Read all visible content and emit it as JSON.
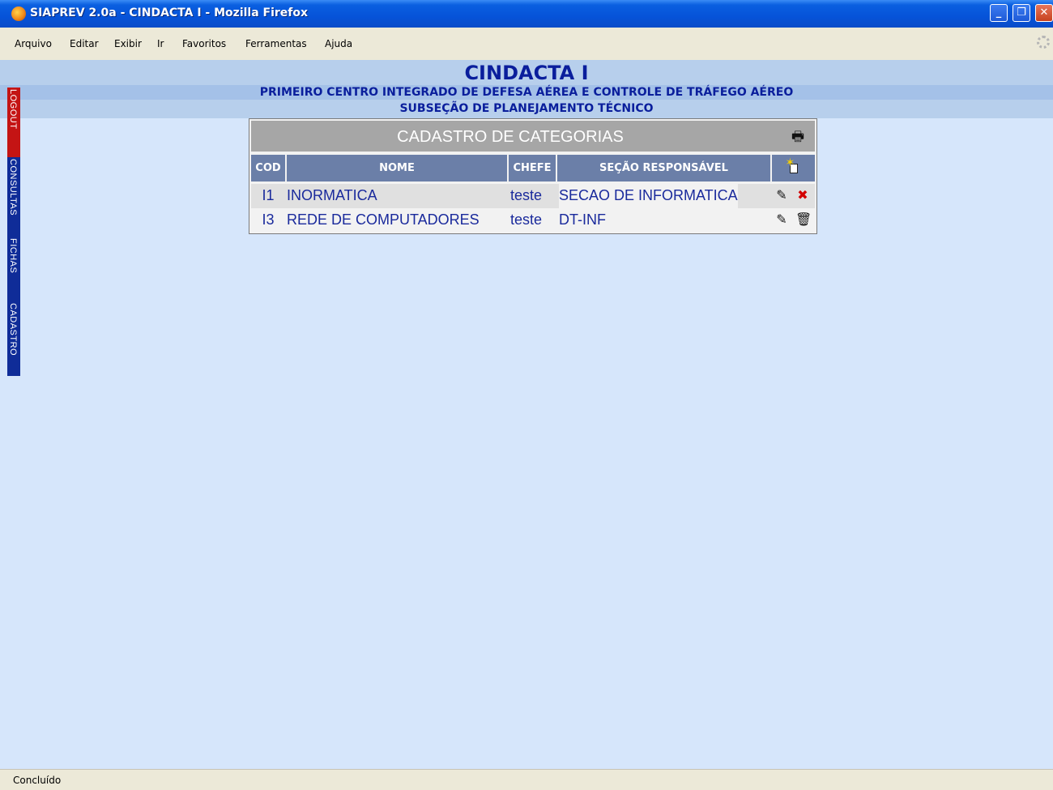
{
  "window": {
    "title": "SIAPREV 2.0a - CINDACTA I - Mozilla Firefox",
    "controls": {
      "minimize": "_",
      "maximize": "❐",
      "close": "✕"
    }
  },
  "menu": [
    "Arquivo",
    "Editar",
    "Exibir",
    "Ir",
    "Favoritos",
    "Ferramentas",
    "Ajuda"
  ],
  "header": {
    "title": "CINDACTA I",
    "subtitle1": "PRIMEIRO CENTRO INTEGRADO DE DEFESA AÉREA E CONTROLE DE TRÁFEGO AÉREO",
    "subtitle2": "SUBSEÇÃO DE PLANEJAMENTO TÉCNICO"
  },
  "sidebar_tabs": [
    "LOGOUT",
    "CONSULTAS",
    "FICHAS",
    "CADASTRO"
  ],
  "table": {
    "title": "CADASTRO DE CATEGORIAS",
    "columns": [
      "COD",
      "NOME",
      "CHEFE",
      "SEÇÃO RESPONSÁVEL"
    ],
    "rows": [
      {
        "cod": "I1",
        "nome": "INORMATICA",
        "chefe": "teste",
        "secao": "SECAO DE INFORMATICA",
        "delete_icon": "delete-disabled-icon"
      },
      {
        "cod": "I3",
        "nome": "REDE DE COMPUTADORES",
        "chefe": "teste",
        "secao": "DT-INF",
        "delete_icon": "trash-icon"
      }
    ],
    "icons": {
      "print": "print-icon",
      "new": "new-record-icon",
      "edit": "edit-icon"
    }
  },
  "status": {
    "text": "Concluído"
  },
  "colors": {
    "link_text": "#1a2a9c",
    "header_text": "#0a1e9c",
    "logout_tab": "#c41414",
    "nav_tab": "#0f2c98",
    "page_bg": "#d6e6fb"
  }
}
